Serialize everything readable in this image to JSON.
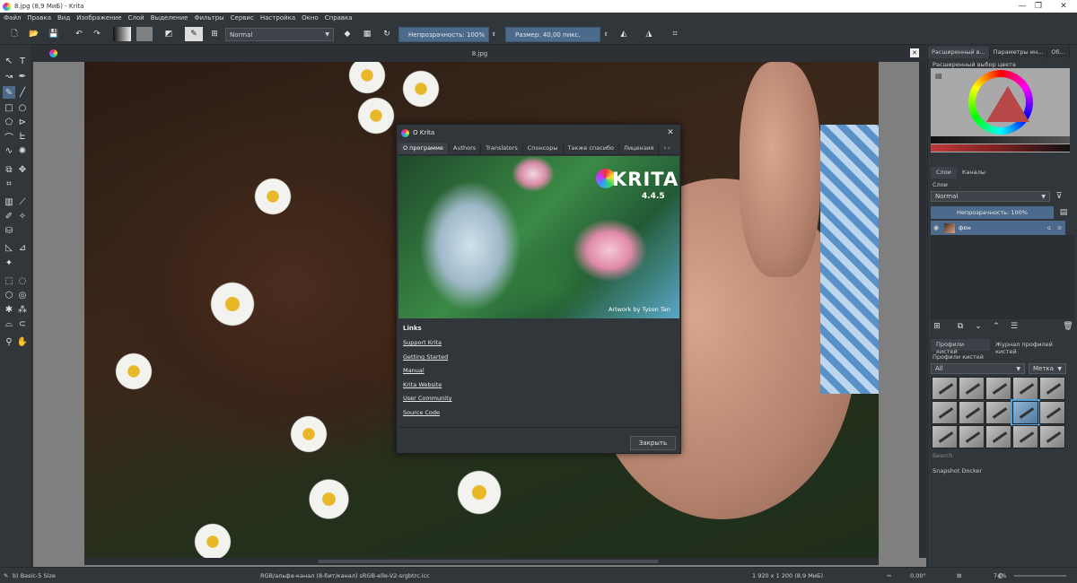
{
  "window": {
    "title": "8.jpg (8,9 МиБ)  - Krita",
    "minimize": "—",
    "maximize": "❐",
    "close": "✕"
  },
  "menu": [
    "Файл",
    "Правка",
    "Вид",
    "Изображение",
    "Слой",
    "Выделение",
    "Фильтры",
    "Сервис",
    "Настройка",
    "Окно",
    "Справка"
  ],
  "toolbar": {
    "blend_mode": "Normal",
    "opacity": "Непрозрачность: 100%",
    "size": "Размер: 40,00 пикс."
  },
  "canvas": {
    "document_tab": "8.jpg",
    "close_icon": "✕"
  },
  "dialog": {
    "title": "О Krita",
    "close": "✕",
    "tabs": [
      "О программе",
      "Authors",
      "Translators",
      "Спонсоры",
      "Также спасибо",
      "Лицензия"
    ],
    "tab_scroll": "‹ ›",
    "logo": "KRITA",
    "version": "4.4.5",
    "artwork_credit": "Artwork by Tyson Tan",
    "links_title": "Links",
    "links": [
      "Support Krita",
      "Getting Started",
      "Manual",
      "Krita Website",
      "User Community",
      "Source Code"
    ],
    "close_button": "Закрыть"
  },
  "dock": {
    "tabs": [
      "Расширенный в...",
      "Параметры ин...",
      "Об..."
    ],
    "color_selector_label": "Расширенный выбор цвета",
    "layers_tabs": [
      "Слои",
      "Каналы"
    ],
    "layers_label": "Слои",
    "layer_blend": "Normal",
    "layer_opacity": "Непрозрачность:  100%",
    "layer_name": "фон",
    "preset_tabs": [
      "Профили кистей",
      "Журнал профилей кистей"
    ],
    "presets_label": "Профили кистей",
    "preset_filter": "All",
    "preset_tag": "Метка",
    "search_placeholder": "Search",
    "snapshot_label": "Snapshot Docker"
  },
  "status": {
    "brush": "b) Basic-5 Size",
    "color_space": "RGB/альфа-канал (8-бит/канал)  sRGB-elle-V2-srgbtrc.icc",
    "dimensions": "1 920 x 1 200 (8,9 МиБ)",
    "rotation": "0,00°",
    "zoom": "74%"
  },
  "colors": {
    "accent": "#4b6a8c",
    "background": "#31363b",
    "selected_preset": "#4b9fdd"
  }
}
